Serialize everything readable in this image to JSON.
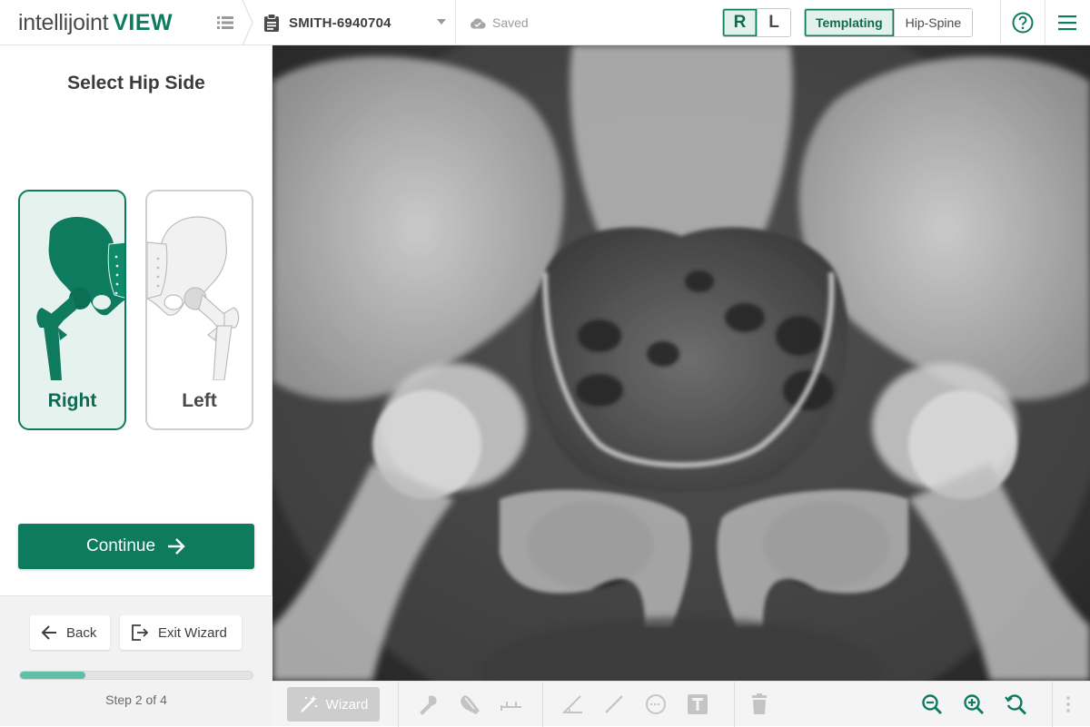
{
  "app": {
    "logo_text": "intellijoint",
    "logo_view": "VIEW"
  },
  "header": {
    "patient_id": "SMITH-6940704",
    "save_status": "Saved",
    "side_toggle": {
      "right": "R",
      "left": "L",
      "active": "R"
    },
    "modes": [
      {
        "label": "Templating",
        "active": true
      },
      {
        "label": "Hip-Spine",
        "active": false
      }
    ]
  },
  "wizard": {
    "title": "Select Hip Side",
    "options": [
      {
        "label": "Right",
        "selected": true
      },
      {
        "label": "Left",
        "selected": false
      }
    ],
    "continue_label": "Continue",
    "back_label": "Back",
    "exit_label": "Exit Wizard",
    "progress_fraction": 0.28,
    "step_text": "Step 2 of 4"
  },
  "toolbar": {
    "wizard_label": "Wizard",
    "icons": [
      "wizard-wand-icon",
      "cup-tool-icon",
      "stem-tool-icon",
      "leg-length-icon",
      "angle-icon",
      "line-icon",
      "circle-icon",
      "text-icon",
      "delete-icon",
      "zoom-out-icon",
      "zoom-in-icon",
      "zoom-reset-icon",
      "more-icon"
    ]
  },
  "colors": {
    "brand_green": "#0e7a5e",
    "selected_bg": "#e6f2ee",
    "progress_fill": "#5fc0a6"
  }
}
